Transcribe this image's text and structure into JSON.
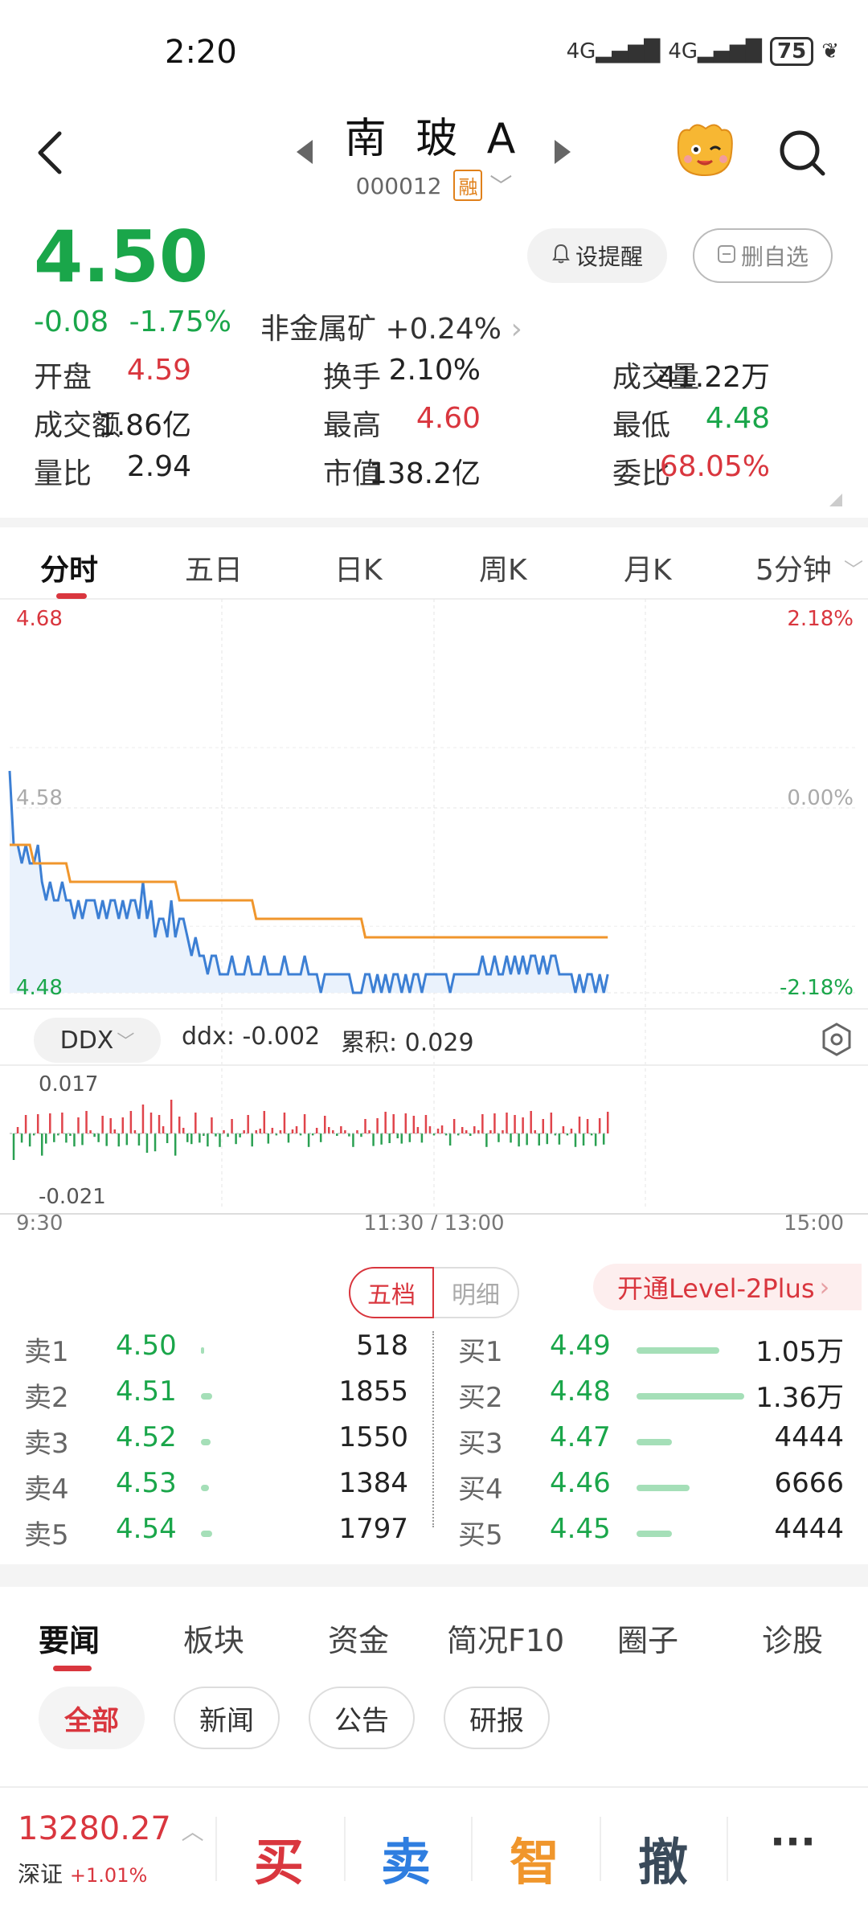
{
  "status_bar": {
    "time": "2:20",
    "signal1": "4G",
    "signal2": "4G",
    "battery": "75"
  },
  "header": {
    "title": "南 玻 A",
    "code": "000012",
    "badge": "融",
    "prev_icon": "triangle-left-icon",
    "next_icon": "triangle-right-icon"
  },
  "quote": {
    "price": "4.50",
    "change": "-0.08",
    "change_pct": "-1.75%",
    "sector": "非金属矿 +0.24%",
    "alert_label": "设提醒",
    "watchlist_label": "删自选",
    "stats": [
      {
        "label": "开盘",
        "value": "4.59",
        "color": "red"
      },
      {
        "label": "换手",
        "value": "2.10%",
        "color": "black"
      },
      {
        "label": "成交量",
        "value": "41.22万",
        "color": "black"
      },
      {
        "label": "成交额",
        "value": "1.86亿",
        "color": "black"
      },
      {
        "label": "最高",
        "value": "4.60",
        "color": "red"
      },
      {
        "label": "最低",
        "value": "4.48",
        "color": "green"
      },
      {
        "label": "量比",
        "value": "2.94",
        "color": "black"
      },
      {
        "label": "市值",
        "value": "138.2亿",
        "color": "black"
      },
      {
        "label": "委比",
        "value": "68.05%",
        "color": "red"
      }
    ]
  },
  "chart_tabs": [
    "分时",
    "五日",
    "日K",
    "周K",
    "月K",
    "5分钟"
  ],
  "chart_data": {
    "type": "line",
    "y_left_labels": [
      "4.68",
      "4.58",
      "4.48"
    ],
    "y_right_labels": [
      "2.18%",
      "0.00%",
      "-2.18%"
    ],
    "x_labels": [
      "9:30",
      "11:30 / 13:00",
      "15:00"
    ],
    "ylim": [
      4.48,
      4.68
    ],
    "series": [
      {
        "values": [
          4.6,
          4.56,
          4.56,
          4.55,
          4.56,
          4.55,
          4.55,
          4.56,
          4.54,
          4.53,
          4.54,
          4.53,
          4.53,
          4.54,
          4.53,
          4.53,
          4.52,
          4.53,
          4.52,
          4.53,
          4.53,
          4.53,
          4.52,
          4.53,
          4.52,
          4.53,
          4.53,
          4.52,
          4.53,
          4.52,
          4.53,
          4.53,
          4.52,
          4.54,
          4.52,
          4.53,
          4.51,
          4.52,
          4.52,
          4.51,
          4.53,
          4.51,
          4.52,
          4.52,
          4.51,
          4.5,
          4.51,
          4.5,
          4.5,
          4.49,
          4.5,
          4.5,
          4.49,
          4.49,
          4.49,
          4.5,
          4.49,
          4.49,
          4.49,
          4.5,
          4.49,
          4.49,
          4.49,
          4.5,
          4.49,
          4.49,
          4.49,
          4.49,
          4.5,
          4.49,
          4.49,
          4.49,
          4.49,
          4.5,
          4.49,
          4.49,
          4.49,
          4.48,
          4.49,
          4.49,
          4.49,
          4.49,
          4.49,
          4.49,
          4.49,
          4.48,
          4.48,
          4.48,
          4.49,
          4.49,
          4.48,
          4.49,
          4.48,
          4.49,
          4.48,
          4.49,
          4.49,
          4.48,
          4.49,
          4.48,
          4.49,
          4.49,
          4.48,
          4.49,
          4.49,
          4.49,
          4.49,
          4.49,
          4.49,
          4.48,
          4.49,
          4.49,
          4.49,
          4.49,
          4.49,
          4.49,
          4.49,
          4.5,
          4.49,
          4.49,
          4.5,
          4.49,
          4.49,
          4.5,
          4.49,
          4.5,
          4.49,
          4.5,
          4.49,
          4.5,
          4.5,
          4.49,
          4.5,
          4.49,
          4.5,
          4.5,
          4.49,
          4.49,
          4.49,
          4.49,
          4.48,
          4.49,
          4.48,
          4.49,
          4.49,
          4.48,
          4.49,
          4.48,
          4.49
        ]
      },
      {
        "values": [
          4.56,
          4.56,
          4.56,
          4.56,
          4.56,
          4.56,
          4.55,
          4.55,
          4.55,
          4.55,
          4.55,
          4.55,
          4.55,
          4.55,
          4.55,
          4.54,
          4.54,
          4.54,
          4.54,
          4.54,
          4.54,
          4.54,
          4.54,
          4.54,
          4.54,
          4.54,
          4.54,
          4.54,
          4.54,
          4.54,
          4.54,
          4.54,
          4.54,
          4.54,
          4.54,
          4.54,
          4.54,
          4.54,
          4.54,
          4.54,
          4.54,
          4.54,
          4.53,
          4.53,
          4.53,
          4.53,
          4.53,
          4.53,
          4.53,
          4.53,
          4.53,
          4.53,
          4.53,
          4.53,
          4.53,
          4.53,
          4.53,
          4.53,
          4.53,
          4.53,
          4.53,
          4.52,
          4.52,
          4.52,
          4.52,
          4.52,
          4.52,
          4.52,
          4.52,
          4.52,
          4.52,
          4.52,
          4.52,
          4.52,
          4.52,
          4.52,
          4.52,
          4.52,
          4.52,
          4.52,
          4.52,
          4.52,
          4.52,
          4.52,
          4.52,
          4.52,
          4.52,
          4.52,
          4.51,
          4.51,
          4.51,
          4.51,
          4.51,
          4.51,
          4.51,
          4.51,
          4.51,
          4.51,
          4.51,
          4.51,
          4.51,
          4.51,
          4.51,
          4.51,
          4.51,
          4.51,
          4.51,
          4.51,
          4.51,
          4.51,
          4.51,
          4.51,
          4.51,
          4.51,
          4.51,
          4.51,
          4.51,
          4.51,
          4.51,
          4.51,
          4.51,
          4.51,
          4.51,
          4.51,
          4.51,
          4.51,
          4.51,
          4.51,
          4.51,
          4.51,
          4.51,
          4.51,
          4.51,
          4.51,
          4.51,
          4.51,
          4.51,
          4.51,
          4.51,
          4.51,
          4.51,
          4.51,
          4.51,
          4.51,
          4.51,
          4.51,
          4.51,
          4.51,
          4.51
        ]
      }
    ]
  },
  "ddx": {
    "selector_label": "DDX",
    "ddx_text": "ddx: -0.002",
    "cum_text": "累积: 0.029",
    "max_label": "0.017",
    "min_label": "-0.021"
  },
  "orderbook": {
    "tab_active": "五档",
    "tab_other": "明细",
    "level2_label": "开通Level-2Plus",
    "asks": [
      {
        "label": "卖1",
        "price": "4.50",
        "vol": "518",
        "bar_pct": 0.02
      },
      {
        "label": "卖2",
        "price": "4.51",
        "vol": "1855",
        "bar_pct": 0.11
      },
      {
        "label": "卖3",
        "price": "4.52",
        "vol": "1550",
        "bar_pct": 0.09
      },
      {
        "label": "卖4",
        "price": "4.53",
        "vol": "1384",
        "bar_pct": 0.08
      },
      {
        "label": "卖5",
        "price": "4.54",
        "vol": "1797",
        "bar_pct": 0.11
      }
    ],
    "bids": [
      {
        "label": "买1",
        "price": "4.49",
        "vol": "1.05万",
        "bar_pct": 0.77
      },
      {
        "label": "买2",
        "price": "4.48",
        "vol": "1.36万",
        "bar_pct": 1.0
      },
      {
        "label": "买3",
        "price": "4.47",
        "vol": "4444",
        "bar_pct": 0.33
      },
      {
        "label": "买4",
        "price": "4.46",
        "vol": "6666",
        "bar_pct": 0.49
      },
      {
        "label": "买5",
        "price": "4.45",
        "vol": "4444",
        "bar_pct": 0.33
      }
    ]
  },
  "news_tabs": [
    "要闻",
    "板块",
    "资金",
    "简况F10",
    "圈子",
    "诊股"
  ],
  "news_chips": [
    "全部",
    "新闻",
    "公告",
    "研报"
  ],
  "bottom_bar": {
    "index_value": "13280.27",
    "index_name": "深证",
    "index_change": "+1.01%",
    "buy": "买",
    "sell": "卖",
    "smart": "智",
    "cancel": "撤",
    "more": "···"
  }
}
